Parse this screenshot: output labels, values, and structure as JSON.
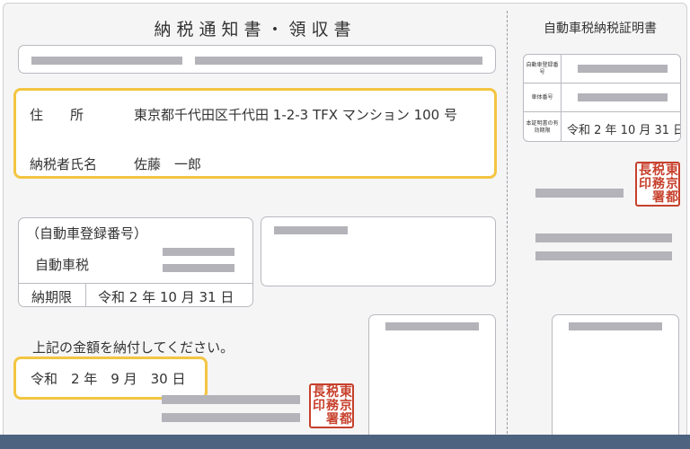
{
  "header": {
    "title": "納税通知書・領収書",
    "certificate_title": "自動車税納税証明書"
  },
  "taxpayer": {
    "address_label": "住　　所",
    "address_value": "東京都千代田区千代田 1-2-3 TFX マンション 100 号",
    "name_label": "納税者氏名",
    "name_value": "佐藤　一郎"
  },
  "tax_box": {
    "registration_label": "（自動車登録番号）",
    "tax_type": "自動車税",
    "deadline_label": "納期限",
    "deadline_value": "令和 2 年 10 月 31 日"
  },
  "instruction": "上記の金額を納付してください。",
  "payment_date": "令和　2 年　9 月　30 日",
  "certificate": {
    "reg_label": "自動車登録番号",
    "body_label": "車体番号",
    "validity_label": "本証明書の有効期限",
    "validity_value": "令和 2 年 10 月 31 日"
  },
  "seal": {
    "text": "東京都税務署長印",
    "columns": [
      "東京都",
      "税務署",
      "長印"
    ],
    "color": "#c7402c"
  },
  "colors": {
    "highlight": "#f3c542",
    "footer": "#4d6380",
    "redacted": "#b3b3b9"
  }
}
